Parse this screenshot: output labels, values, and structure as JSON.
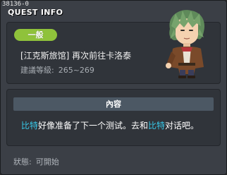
{
  "window": {
    "id_label": "38136-0",
    "title": "QUEST INFO"
  },
  "quest": {
    "category_badge": "一般",
    "name": "[江克斯旅馆] 再次前往卡洛泰",
    "level_label": "建議等級:",
    "level_range": "265~269"
  },
  "npc": {
    "icon": "npc-portrait-green-hair"
  },
  "content": {
    "header": "內容",
    "segments": [
      {
        "text": "比特",
        "highlight": true
      },
      {
        "text": "好像准备了下一个测试。去和",
        "highlight": false
      },
      {
        "text": "比特",
        "highlight": true
      },
      {
        "text": "对话吧。",
        "highlight": false
      }
    ],
    "highlight_color": "#38c8e8"
  },
  "status": {
    "label": "狀態:",
    "value": "可開始"
  },
  "colors": {
    "badge": "#8fc23b",
    "panel": "#30343a",
    "window": "#3b3f46"
  }
}
